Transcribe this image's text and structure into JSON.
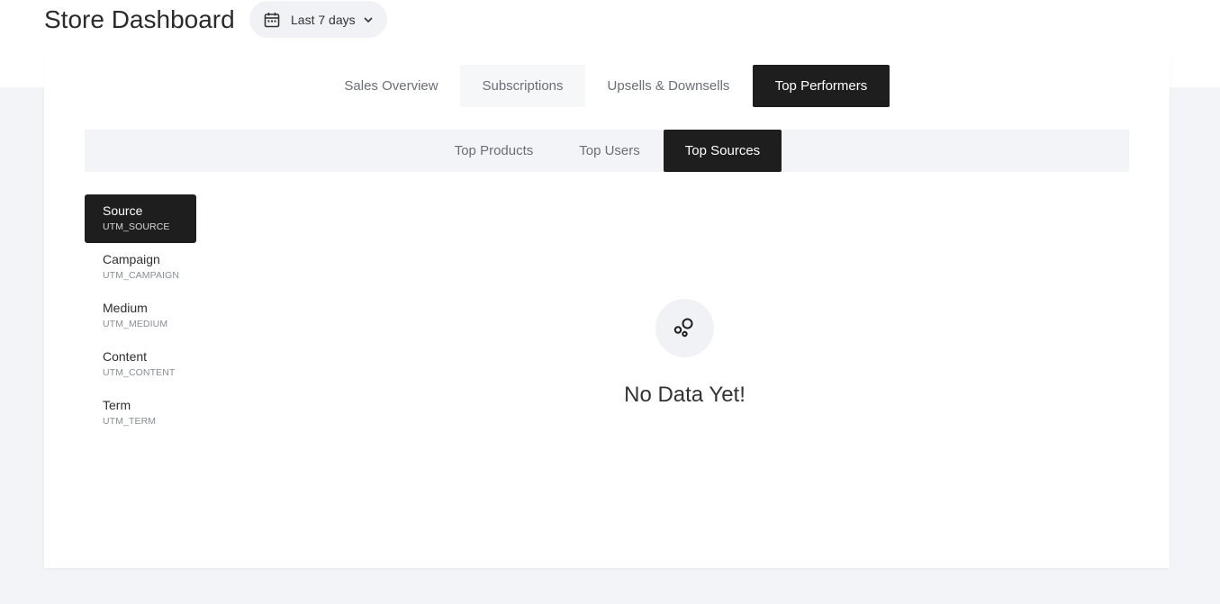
{
  "header": {
    "title": "Store Dashboard",
    "date_range": "Last 7 days"
  },
  "main_tabs": [
    {
      "label": "Sales Overview",
      "state": "default"
    },
    {
      "label": "Subscriptions",
      "state": "hover"
    },
    {
      "label": "Upsells & Downsells",
      "state": "default"
    },
    {
      "label": "Top Performers",
      "state": "active"
    }
  ],
  "sub_tabs": [
    {
      "label": "Top Products",
      "state": "default"
    },
    {
      "label": "Top Users",
      "state": "default"
    },
    {
      "label": "Top Sources",
      "state": "active"
    }
  ],
  "utm_filters": [
    {
      "name": "Source",
      "key": "UTM_SOURCE",
      "active": true
    },
    {
      "name": "Campaign",
      "key": "UTM_CAMPAIGN",
      "active": false
    },
    {
      "name": "Medium",
      "key": "UTM_MEDIUM",
      "active": false
    },
    {
      "name": "Content",
      "key": "UTM_CONTENT",
      "active": false
    },
    {
      "name": "Term",
      "key": "UTM_TERM",
      "active": false
    }
  ],
  "empty_state": {
    "icon": "bubbles-icon",
    "message": "No Data Yet!"
  },
  "colors": {
    "active_bg": "#1e1e1e",
    "page_bg": "#f3f4f8",
    "muted_text": "#6b6e78"
  }
}
